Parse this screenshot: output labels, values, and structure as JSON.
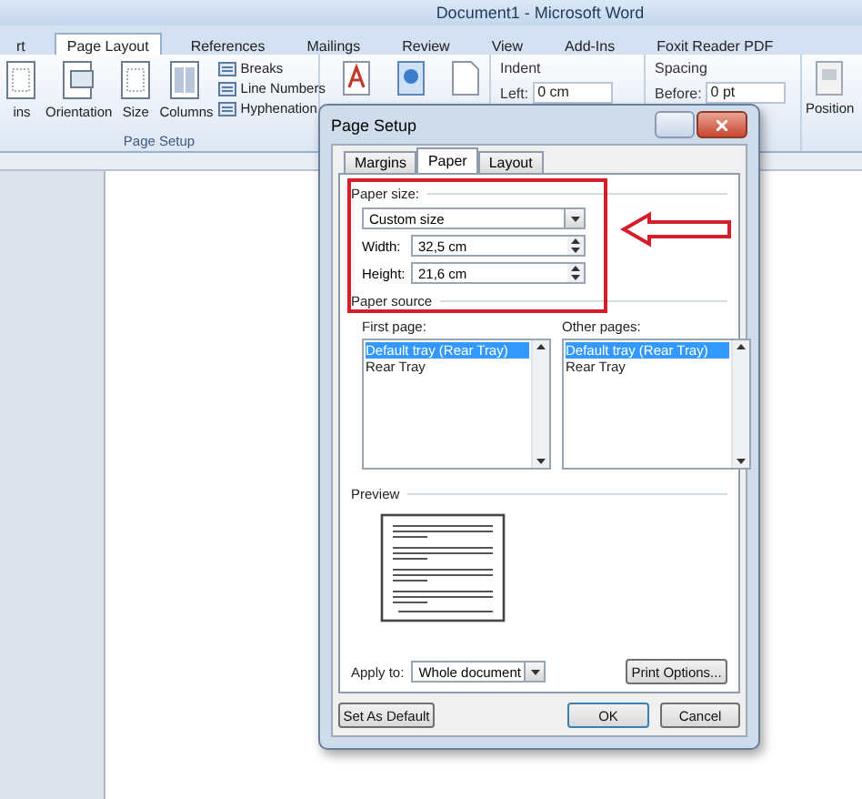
{
  "window": {
    "title": "Document1 - Microsoft Word"
  },
  "ribbon_tabs": [
    {
      "label": "rt",
      "selected": false
    },
    {
      "label": "Page Layout",
      "selected": true
    },
    {
      "label": "References",
      "selected": false
    },
    {
      "label": "Mailings",
      "selected": false
    },
    {
      "label": "Review",
      "selected": false
    },
    {
      "label": "View",
      "selected": false
    },
    {
      "label": "Add-Ins",
      "selected": false
    },
    {
      "label": "Foxit Reader PDF",
      "selected": false
    }
  ],
  "page_setup_group": {
    "label": "Page Setup",
    "large_buttons": [
      "ins",
      "Orientation",
      "Size",
      "Columns"
    ],
    "small_buttons": [
      "Breaks",
      "Line Numbers",
      "Hyphenation"
    ]
  },
  "indent": {
    "label": "Indent",
    "field_label": "Left:",
    "value": "0 cm"
  },
  "spacing": {
    "label": "Spacing",
    "field_label": "Before:",
    "value": "0 pt"
  },
  "position_button": "Position",
  "dialog": {
    "title": "Page Setup",
    "tabs": [
      {
        "label": "Margins",
        "selected": false
      },
      {
        "label": "Paper",
        "selected": true
      },
      {
        "label": "Layout",
        "selected": false
      }
    ],
    "paper_size": {
      "label": "Paper size:",
      "value": "Custom size"
    },
    "width": {
      "label": "Width:",
      "value": "32,5 cm"
    },
    "height": {
      "label": "Height:",
      "value": "21,6 cm"
    },
    "paper_source_label": "Paper source",
    "first_page": {
      "label": "First page:",
      "items": [
        {
          "label": "Default tray (Rear Tray)",
          "selected": true
        },
        {
          "label": "Rear Tray",
          "selected": false
        }
      ]
    },
    "other_pages": {
      "label": "Other pages:",
      "items": [
        {
          "label": "Default tray (Rear Tray)",
          "selected": true
        },
        {
          "label": "Rear Tray",
          "selected": false
        }
      ]
    },
    "preview_label": "Preview",
    "apply_to": {
      "label": "Apply to:",
      "value": "Whole document"
    },
    "print_options": "Print Options...",
    "set_as_default": "Set As Default",
    "ok": "OK",
    "cancel": "Cancel"
  }
}
